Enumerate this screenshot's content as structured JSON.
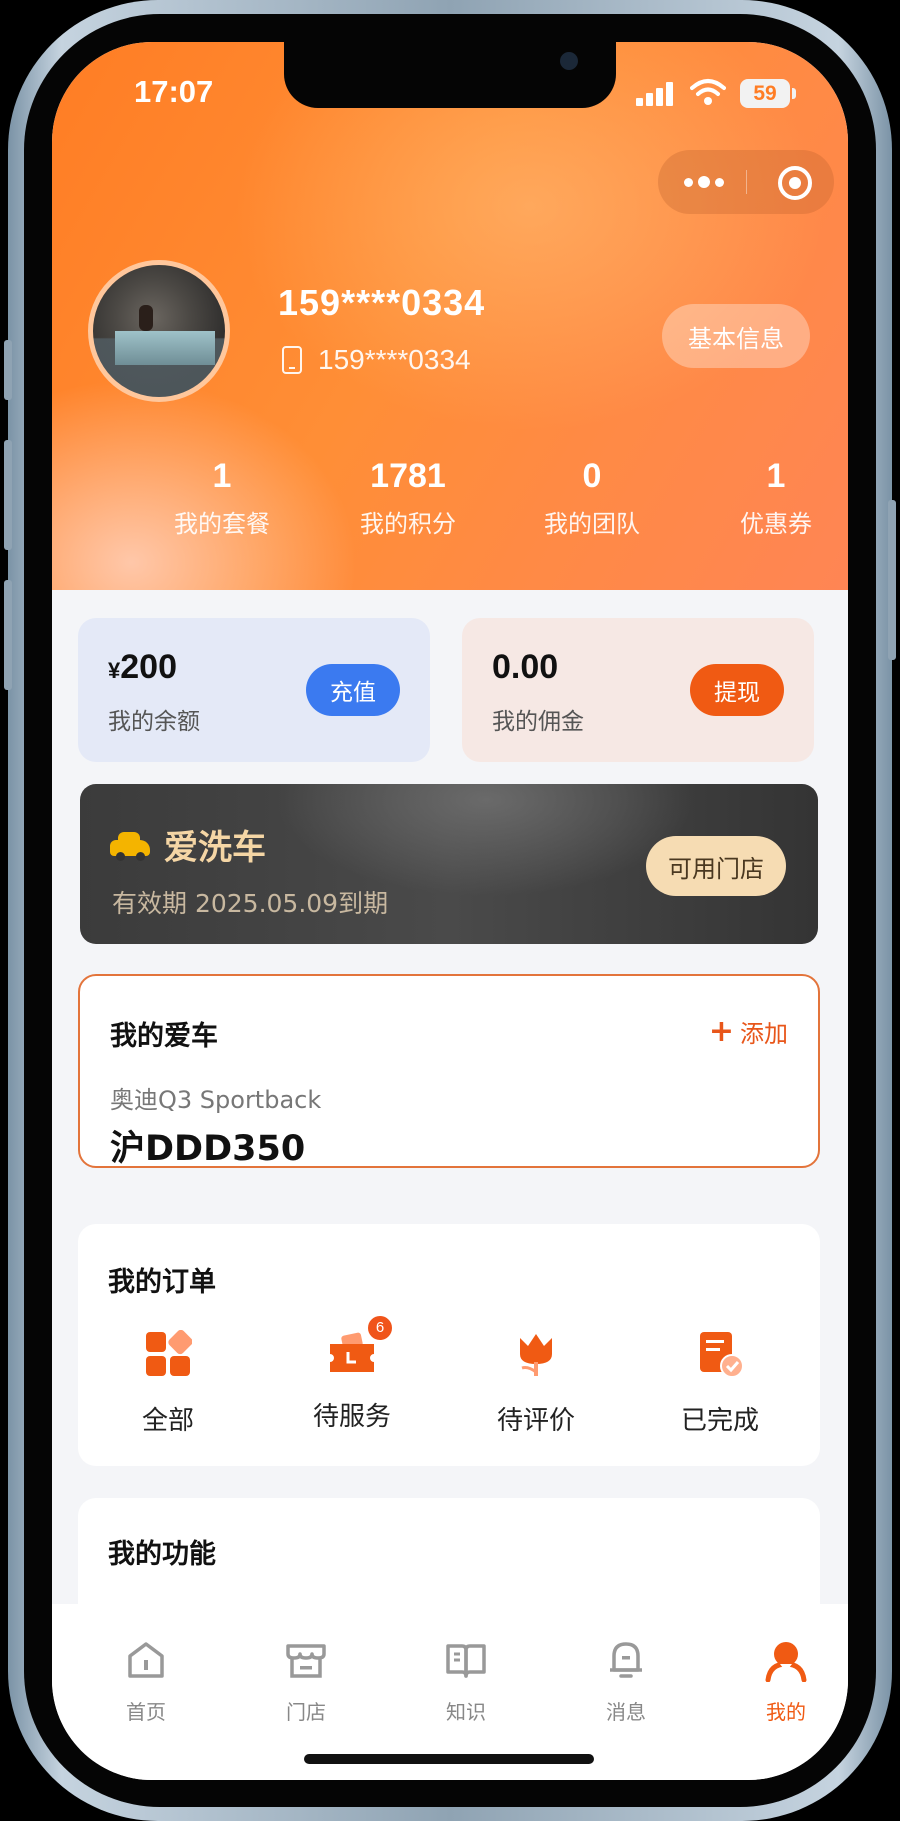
{
  "status_bar": {
    "time": "17:07",
    "battery": "59"
  },
  "profile": {
    "nickname": "159****0334",
    "phone": "159****0334",
    "basic_info_button": "基本信息"
  },
  "stats": [
    {
      "value": "1",
      "label": "我的套餐"
    },
    {
      "value": "1781",
      "label": "我的积分"
    },
    {
      "value": "0",
      "label": "我的团队"
    },
    {
      "value": "1",
      "label": "优惠券"
    }
  ],
  "wallet": {
    "balance": {
      "currency": "¥",
      "amount": "200",
      "label": "我的余额",
      "button": "充值"
    },
    "commission": {
      "amount": "0.00",
      "label": "我的佣金",
      "button": "提现"
    }
  },
  "membership": {
    "name": "爱洗车",
    "expiry": "有效期 2025.05.09到期",
    "stores_button": "可用门店"
  },
  "my_car": {
    "title": "我的爱车",
    "add_label": "添加",
    "model": "奥迪Q3 Sportback",
    "plate": "沪DDD350"
  },
  "orders": {
    "title": "我的订单",
    "items": [
      {
        "label": "全部",
        "icon": "grid-icon"
      },
      {
        "label": "待服务",
        "icon": "ticket-icon",
        "badge": "6"
      },
      {
        "label": "待评价",
        "icon": "tulip-icon"
      },
      {
        "label": "已完成",
        "icon": "document-check-icon"
      }
    ]
  },
  "functions": {
    "title": "我的功能"
  },
  "tabbar": {
    "items": [
      {
        "label": "首页",
        "icon": "home-icon"
      },
      {
        "label": "门店",
        "icon": "store-icon"
      },
      {
        "label": "知识",
        "icon": "book-icon"
      },
      {
        "label": "消息",
        "icon": "bell-icon"
      },
      {
        "label": "我的",
        "icon": "profile-icon",
        "active": true
      }
    ]
  },
  "colors": {
    "accent": "#f05a13",
    "header_orange": "#ff7d24",
    "blue_button": "#3b7af0",
    "gold_text": "#f5d6a5"
  }
}
